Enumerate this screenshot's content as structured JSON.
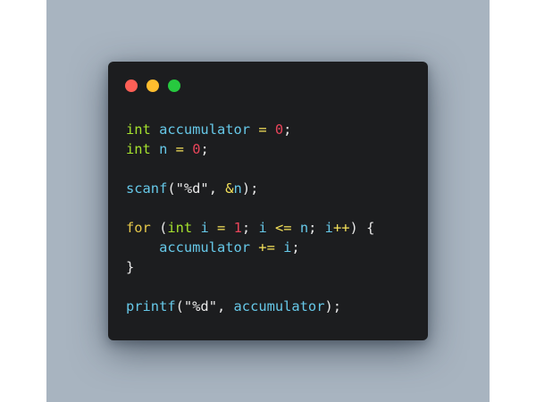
{
  "colors": {
    "backdrop": "#a8b4c0",
    "window_background": "#1c1d1f",
    "dot_close": "#ff5f56",
    "dot_minimize": "#ffbd2e",
    "dot_maximize": "#27c93f"
  },
  "window_controls": [
    "close",
    "minimize",
    "maximize"
  ],
  "code": {
    "language": "c",
    "lines": [
      "int accumulator = 0;",
      "int n = 0;",
      "",
      "scanf(\"%d\", &n);",
      "",
      "for (int i = 1; i <= n; i++) {",
      "    accumulator += i;",
      "}",
      "",
      "printf(\"%d\", accumulator);"
    ]
  }
}
